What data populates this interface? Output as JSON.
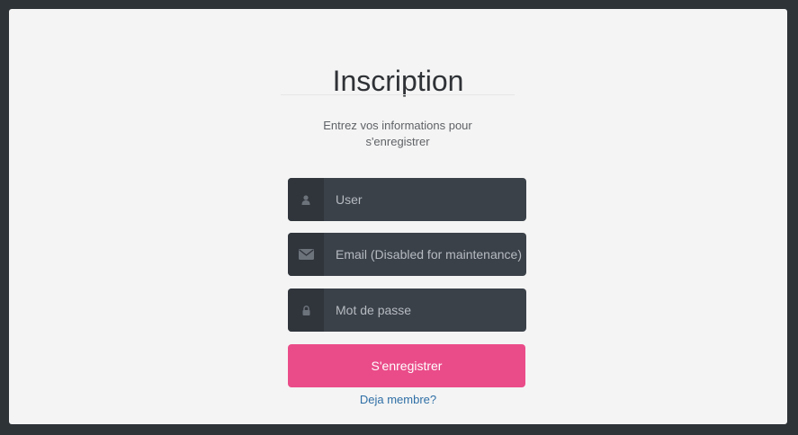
{
  "form": {
    "title": "Inscription",
    "subtitle": "Entrez vos informations pour s'enregistrer",
    "fields": {
      "user": {
        "placeholder": "User",
        "icon": "user-icon"
      },
      "email": {
        "placeholder": "Email (Disabled for maintenance)",
        "icon": "envelope-icon",
        "disabled": true
      },
      "password": {
        "placeholder": "Mot de passe",
        "icon": "lock-icon"
      }
    },
    "submit_label": "S'enregistrer",
    "login_link": "Deja membre?"
  },
  "colors": {
    "background": "#2e3338",
    "panel": "#f4f4f4",
    "field": "#3b4149",
    "addon": "#30353c",
    "accent": "#ea4c89",
    "link": "#2f6fa6"
  }
}
